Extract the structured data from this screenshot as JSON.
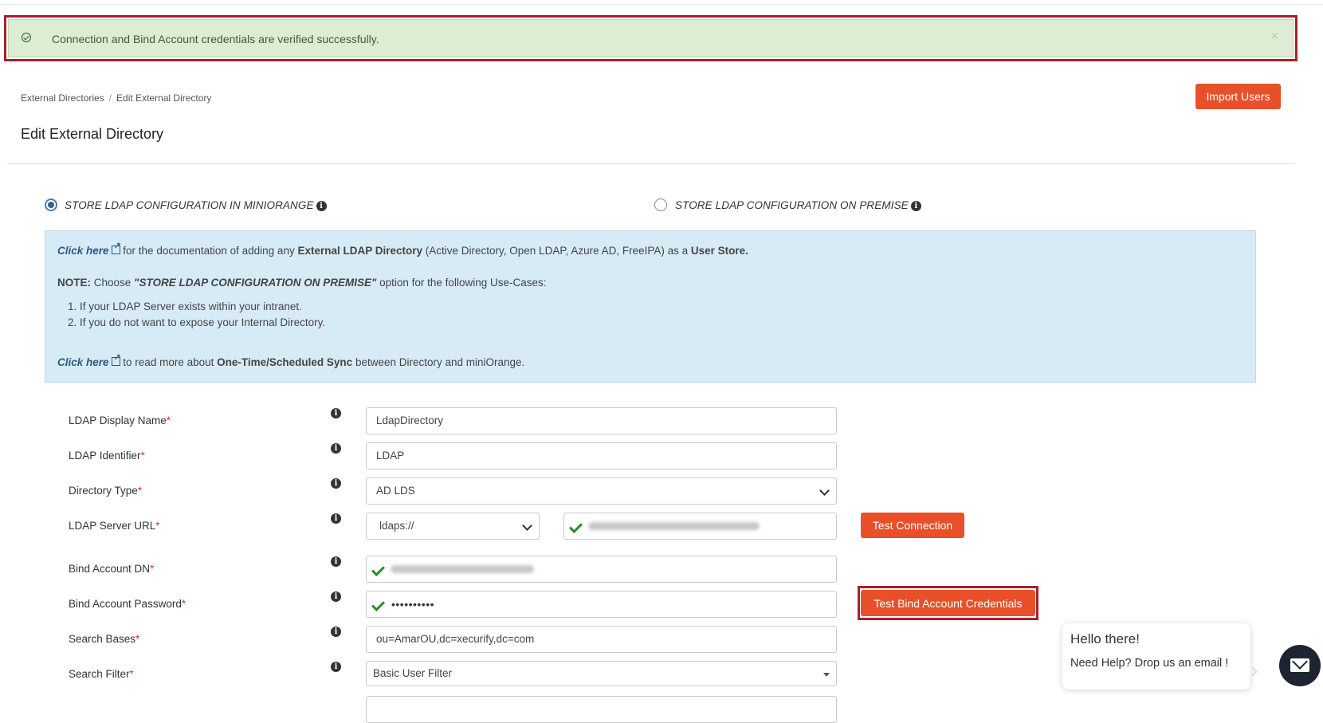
{
  "alert": {
    "message": "Connection and Bind Account credentials are verified successfully.",
    "close": "×"
  },
  "breadcrumb": [
    "External Directories",
    "Edit External Directory"
  ],
  "header": {
    "title": "Edit External Directory",
    "import_button": "Import Users"
  },
  "storage": {
    "options": [
      {
        "label": "STORE LDAP CONFIGURATION IN MINIORANGE",
        "selected": true
      },
      {
        "label": "STORE LDAP CONFIGURATION ON PREMISE",
        "selected": false
      }
    ]
  },
  "info": {
    "link1": "Click here",
    "line1_a": " for the documentation of adding any ",
    "line1_b": "External LDAP Directory",
    "line1_c": " (Active Directory, Open LDAP, Azure AD, FreeIPA) as a ",
    "line1_d": "User Store.",
    "note_label": "NOTE:",
    "note_a": " Choose ",
    "note_b": "\"STORE LDAP CONFIGURATION ON PREMISE\"",
    "note_c": " option for the following Use-Cases:",
    "use_cases": [
      "If your LDAP Server exists within your intranet.",
      "If you do not want to expose your Internal Directory."
    ],
    "link2": "Click here",
    "line2_a": " to read more about ",
    "line2_b": "One-Time/Scheduled Sync",
    "line2_c": " between Directory and miniOrange."
  },
  "form": {
    "display_name": {
      "label": "LDAP Display Name",
      "value": "LdapDirectory"
    },
    "identifier": {
      "label": "LDAP Identifier",
      "value": "LDAP"
    },
    "directory_type": {
      "label": "Directory Type",
      "value": "AD LDS"
    },
    "server_url": {
      "label": "LDAP Server URL",
      "protocol": "ldaps://"
    },
    "test_connection": "Test Connection",
    "bind_dn": {
      "label": "Bind Account DN"
    },
    "bind_password": {
      "label": "Bind Account Password",
      "value": "••••••••••"
    },
    "test_bind": "Test Bind Account Credentials",
    "search_bases": {
      "label": "Search Bases",
      "value": "ou=AmarOU,dc=xecurify,dc=com"
    },
    "search_filter": {
      "label": "Search Filter",
      "value": "Basic User Filter"
    },
    "required_mark": "*",
    "info_glyph": "i"
  },
  "chat": {
    "greeting": "Hello there!",
    "subtitle": "Need Help? Drop us an email !"
  },
  "colors": {
    "accent": "#e8502a",
    "success_bg": "#dcedd4",
    "info_bg": "#d7ebf7",
    "highlight": "#a8202b"
  },
  "icons": [
    "check-circle-icon",
    "close-icon",
    "info-icon",
    "external-link-icon",
    "checkmark-icon",
    "chevron-down-icon",
    "mail-icon"
  ]
}
